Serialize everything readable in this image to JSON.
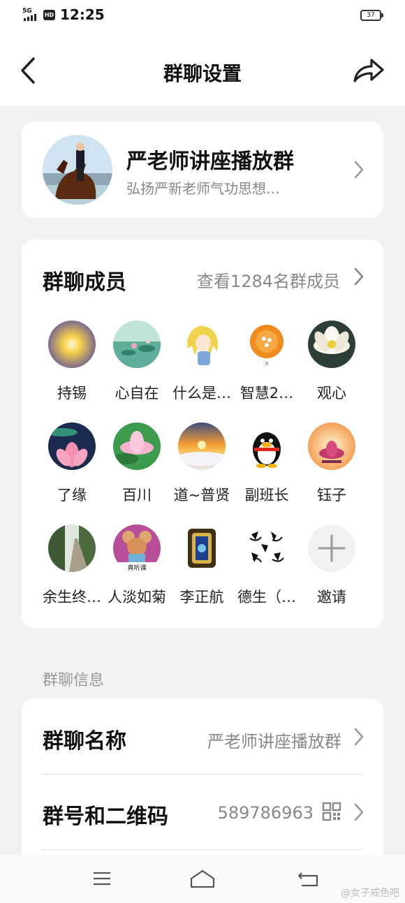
{
  "status_bar": {
    "network": "5G",
    "hd_label": "HD",
    "time": "12:25",
    "battery": "37"
  },
  "header": {
    "title": "群聊设置"
  },
  "group": {
    "name": "严老师讲座播放群",
    "description": "弘扬严新老师气功思想…"
  },
  "members": {
    "heading": "群聊成员",
    "view_all": "查看1284名群成员",
    "list": [
      {
        "name": "持锡",
        "icon": "sun-avatar"
      },
      {
        "name": "心自在",
        "icon": "lotus-pond-avatar"
      },
      {
        "name": "什么是…",
        "icon": "anime-girl-avatar"
      },
      {
        "name": "智慧2…",
        "icon": "orange-sphere-avatar"
      },
      {
        "name": "观心",
        "icon": "white-lotus-avatar"
      },
      {
        "name": "了缘",
        "icon": "pink-lotus-avatar"
      },
      {
        "name": "百川",
        "icon": "lotus-leaf-avatar"
      },
      {
        "name": "道~普贤",
        "icon": "sunset-clouds-avatar"
      },
      {
        "name": "副班长",
        "icon": "penguin-avatar"
      },
      {
        "name": "钰子",
        "icon": "lotus-rays-avatar"
      },
      {
        "name": "余生终…",
        "icon": "forest-path-avatar"
      },
      {
        "name": "人淡如菊",
        "icon": "cartoon-mouse-avatar"
      },
      {
        "name": "李正航",
        "icon": "shrine-avatar"
      },
      {
        "name": "德生（…",
        "icon": "calligraphy-avatar"
      },
      {
        "name": "邀请",
        "icon": "plus-icon"
      }
    ],
    "avatar_badges": {
      "zhihui": "X",
      "mouse": "真听课"
    }
  },
  "info": {
    "section_title": "群聊信息",
    "rows": [
      {
        "label": "群聊名称",
        "value": "严老师讲座播放群"
      },
      {
        "label": "群号和二维码",
        "value": "589786963"
      }
    ]
  },
  "watermark": "@女子戒色吧",
  "colors": {
    "background": "#f1f1f4",
    "card": "#ffffff",
    "secondary_text": "#888888"
  }
}
